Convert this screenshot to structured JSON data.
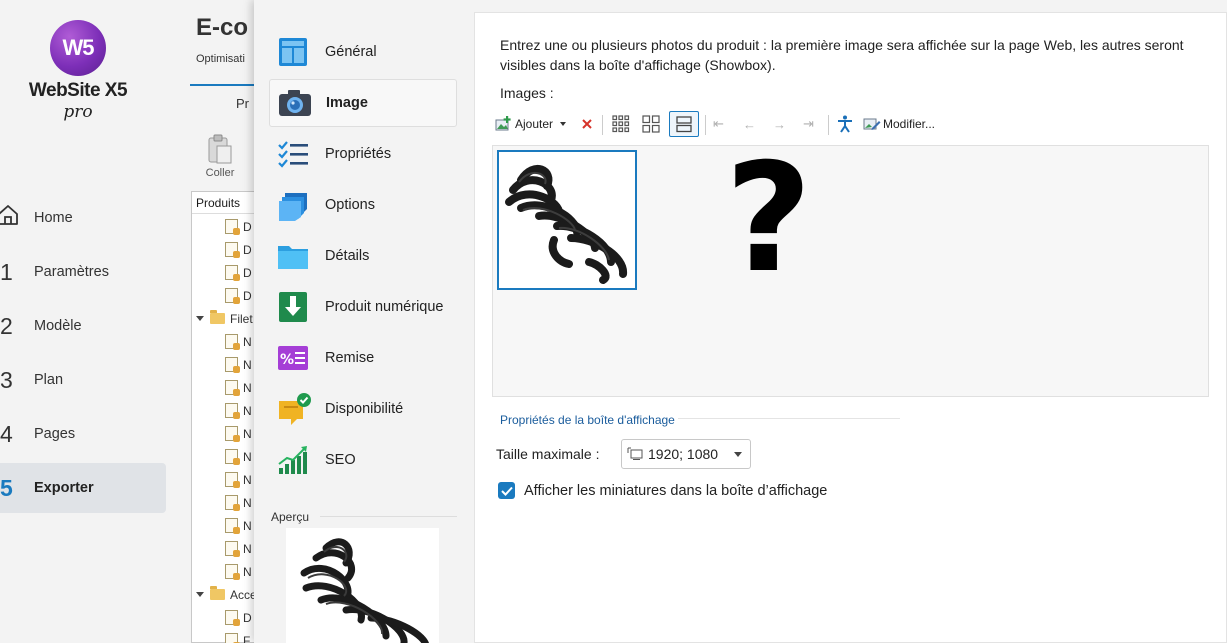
{
  "app": {
    "logo_mark": "W5",
    "logo_text": "WebSite X5",
    "logo_sub": "pro"
  },
  "nav": {
    "items": [
      {
        "num": "",
        "label": "Home",
        "icon": "home-icon"
      },
      {
        "num": "1",
        "label": "Paramètres"
      },
      {
        "num": "2",
        "label": "Modèle"
      },
      {
        "num": "3",
        "label": "Plan"
      },
      {
        "num": "4",
        "label": "Pages"
      },
      {
        "num": "5",
        "label": "Exporter",
        "active": true
      }
    ],
    "accent": "#1a7abf"
  },
  "background_panel": {
    "title": "E-co",
    "subtitle": "Optimisati",
    "tab": "Pr",
    "paste_label": "Coller",
    "tree_header": "Produits",
    "tree_rows": [
      {
        "type": "doc",
        "text": "D"
      },
      {
        "type": "doc",
        "text": "D"
      },
      {
        "type": "doc",
        "text": "D"
      },
      {
        "type": "doc",
        "text": "D"
      },
      {
        "type": "folder",
        "text": "Filet"
      },
      {
        "type": "doc",
        "text": "N"
      },
      {
        "type": "doc",
        "text": "N"
      },
      {
        "type": "doc",
        "text": "N"
      },
      {
        "type": "doc",
        "text": "N"
      },
      {
        "type": "doc",
        "text": "N"
      },
      {
        "type": "doc",
        "text": "N"
      },
      {
        "type": "doc",
        "text": "N"
      },
      {
        "type": "doc",
        "text": "N"
      },
      {
        "type": "doc",
        "text": "N"
      },
      {
        "type": "doc",
        "text": "N"
      },
      {
        "type": "doc",
        "text": "N"
      },
      {
        "type": "folder",
        "text": "Acce"
      },
      {
        "type": "doc",
        "text": "D"
      },
      {
        "type": "doc",
        "text": "F"
      }
    ]
  },
  "dialog": {
    "sections": [
      {
        "label": "Général",
        "icon": "general-icon"
      },
      {
        "label": "Image",
        "icon": "camera-icon",
        "active": true
      },
      {
        "label": "Propriétés",
        "icon": "properties-list-icon"
      },
      {
        "label": "Options",
        "icon": "options-layers-icon"
      },
      {
        "label": "Détails",
        "icon": "details-folder-icon"
      },
      {
        "label": "Produit numérique",
        "icon": "download-icon"
      },
      {
        "label": "Remise",
        "icon": "discount-percent-icon"
      },
      {
        "label": "Disponibilité",
        "icon": "availability-check-icon"
      },
      {
        "label": "SEO",
        "icon": "seo-chart-icon"
      }
    ],
    "preview_label": "Aperçu"
  },
  "content": {
    "intro": "Entrez une ou plusieurs photos du produit : la première image sera affichée sur la page Web, les autres seront visibles dans la boîte d'affichage (Showbox).",
    "images_label": "Images :",
    "toolbar": {
      "add_label": "Ajouter",
      "edit_label": "Modifier..."
    },
    "gallery_placeholder": "?",
    "showbox_section_label": "Propriétés de la boîte d'affichage",
    "max_size_label": "Taille maximale :",
    "max_size_value": "1920; 1080",
    "show_thumbs_label": "Afficher les miniatures dans la boîte d’affichage",
    "show_thumbs_checked": true
  }
}
